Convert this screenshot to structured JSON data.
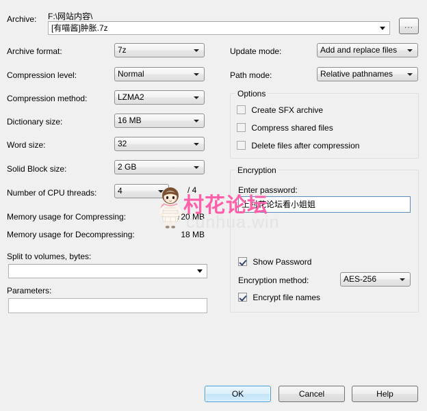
{
  "dialog": {
    "archive_label": "Archive:",
    "archive_path": "F:\\网站内容\\",
    "archive_name": "[有喵酱]肿胀.7z",
    "browse_label": "...",
    "left": {
      "archive_format_label": "Archive format:",
      "archive_format_value": "7z",
      "compression_level_label": "Compression level:",
      "compression_level_value": "Normal",
      "compression_method_label": "Compression method:",
      "compression_method_value": "LZMA2",
      "dictionary_size_label": "Dictionary size:",
      "dictionary_size_value": "16 MB",
      "word_size_label": "Word size:",
      "word_size_value": "32",
      "solid_block_label": "Solid Block size:",
      "solid_block_value": "2 GB",
      "cpu_threads_label": "Number of CPU threads:",
      "cpu_threads_value": "4",
      "cpu_threads_total": "/ 4",
      "mem_compress_label": "Memory usage for Compressing:",
      "mem_compress_value": "720 MB",
      "mem_decompress_label": "Memory usage for Decompressing:",
      "mem_decompress_value": "18 MB",
      "split_label": "Split to volumes, bytes:",
      "split_value": "",
      "parameters_label": "Parameters:",
      "parameters_value": ""
    },
    "right": {
      "update_mode_label": "Update mode:",
      "update_mode_value": "Add and replace files",
      "path_mode_label": "Path mode:",
      "path_mode_value": "Relative pathnames",
      "options_group_title": "Options",
      "options": [
        {
          "label": "Create SFX archive",
          "checked": false,
          "disabled": true
        },
        {
          "label": "Compress shared files",
          "checked": false,
          "disabled": true
        },
        {
          "label": "Delete files after compression",
          "checked": false,
          "disabled": true
        }
      ],
      "encryption_group_title": "Encryption",
      "password_label": "Enter password:",
      "password_value": "上村花论坛看小姐姐",
      "show_password_label": "Show Password",
      "show_password_checked": true,
      "encryption_method_label": "Encryption method:",
      "encryption_method_value": "AES-256",
      "encrypt_file_names_label": "Encrypt file names",
      "encrypt_file_names_checked": true
    },
    "buttons": {
      "ok": "OK",
      "cancel": "Cancel",
      "help": "Help"
    }
  },
  "watermark": {
    "pink_text": "村花论坛",
    "gray_text": "cunhua.win",
    "pink_color": "#ff5fa8",
    "gray_color": "#e3e3e3"
  }
}
